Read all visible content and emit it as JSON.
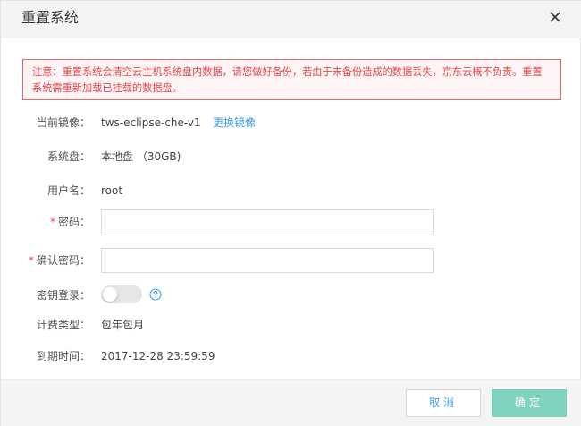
{
  "dialog": {
    "title": "重置系统"
  },
  "notice": {
    "text": "注意：重置系统会清空云主机系统盘内数据，请您做好备份，若由于未备份造成的数据丢失，京东云概不负责。重置系统需重新加载已挂载的数据盘。"
  },
  "form": {
    "image": {
      "label": "当前镜像：",
      "value": "tws-eclipse-che-v1",
      "link": "更换镜像"
    },
    "system_disk": {
      "label": "系统盘：",
      "value": "本地盘 （30GB)"
    },
    "username": {
      "label": "用户名：",
      "value": "root"
    },
    "password": {
      "required_mark": "*",
      "label": "密码：",
      "value": "",
      "placeholder": ""
    },
    "confirm_password": {
      "required_mark": "*",
      "label": "确认密码：",
      "value": "",
      "placeholder": ""
    },
    "key_login": {
      "label": "密钥登录：",
      "enabled": false
    },
    "billing_type": {
      "label": "计费类型：",
      "value": "包年包月"
    },
    "expire_time": {
      "label": "到期时间：",
      "value": "2017-12-28 23:59:59"
    }
  },
  "footer": {
    "cancel_label": "取消",
    "ok_label": "确定"
  },
  "colors": {
    "accent": "#3f9fe0",
    "warning": "#e1454a",
    "ok_button": "#7fd3bf"
  }
}
